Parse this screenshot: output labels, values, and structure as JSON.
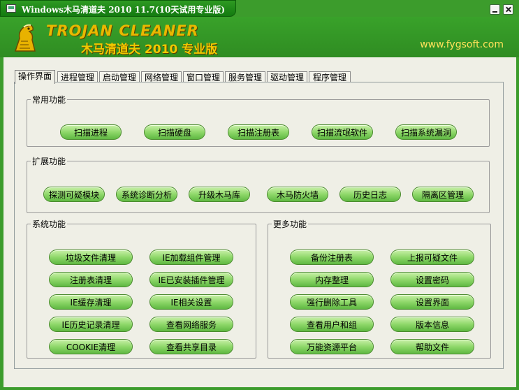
{
  "window": {
    "title": "Windows木马清道夫 2010 11.7(10天试用专业版)"
  },
  "banner": {
    "logo_en": "TROJAN CLEANER",
    "logo_cn": "木马清道夫 2010 专业版",
    "website": "www.fygsoft.com"
  },
  "tabs": [
    {
      "label": "操作界面",
      "active": true
    },
    {
      "label": "进程管理"
    },
    {
      "label": "启动管理"
    },
    {
      "label": "网络管理"
    },
    {
      "label": "窗口管理"
    },
    {
      "label": "服务管理"
    },
    {
      "label": "驱动管理"
    },
    {
      "label": "程序管理"
    }
  ],
  "groups": {
    "common": {
      "title": "常用功能",
      "buttons": [
        "扫描进程",
        "扫描硬盘",
        "扫描注册表",
        "扫描流氓软件",
        "扫描系统漏洞"
      ]
    },
    "extend": {
      "title": "扩展功能",
      "buttons": [
        "探测可疑模块",
        "系统诊断分析",
        "升级木马库",
        "木马防火墙",
        "历史日志",
        "隔离区管理"
      ]
    },
    "system": {
      "title": "系统功能",
      "buttons": [
        "垃圾文件清理",
        "IE加载组件管理",
        "注册表清理",
        "IE已安装插件管理",
        "IE缓存清理",
        "IE相关设置",
        "IE历史记录清理",
        "查看网络服务",
        "COOKIE清理",
        "查看共享目录"
      ]
    },
    "more": {
      "title": "更多功能",
      "buttons": [
        "备份注册表",
        "上报可疑文件",
        "内存整理",
        "设置密码",
        "强行删除工具",
        "设置界面",
        "查看用户和组",
        "版本信息",
        "万能资源平台",
        "帮助文件"
      ]
    }
  }
}
